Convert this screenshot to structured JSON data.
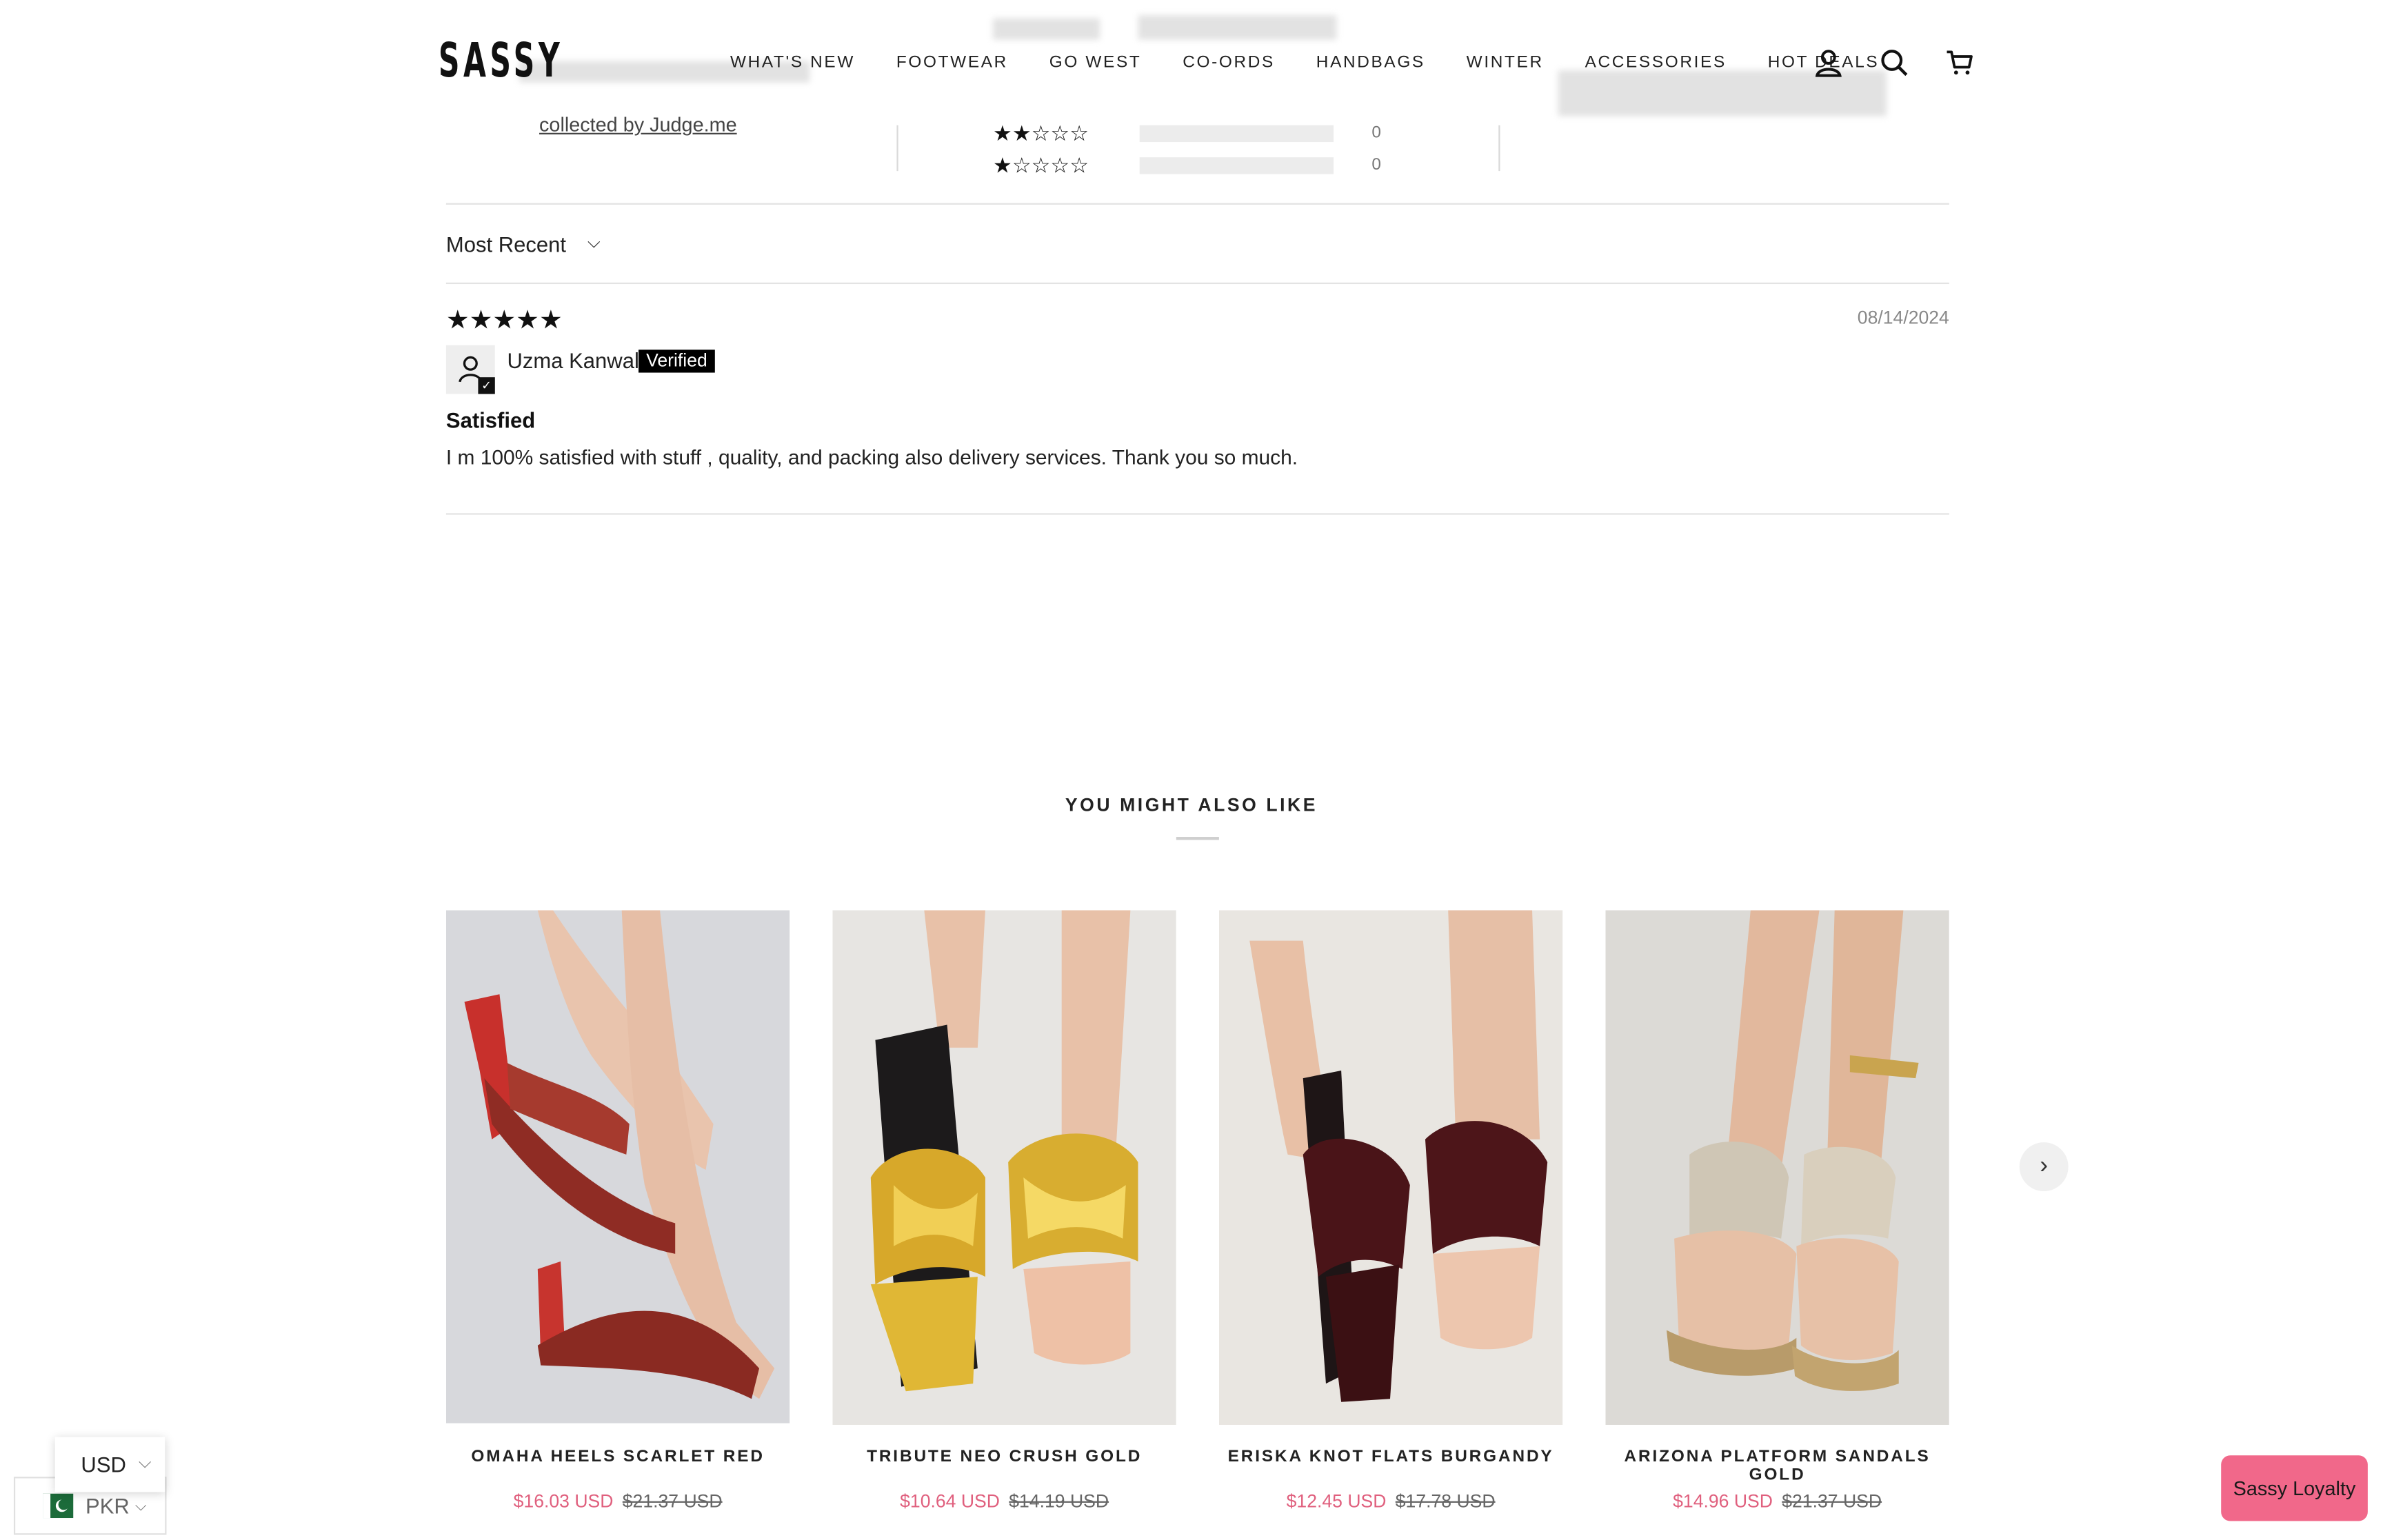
{
  "header": {
    "logo": "SASSY",
    "nav": [
      "WHAT'S NEW",
      "FOOTWEAR",
      "GO WEST",
      "CO-ORDS",
      "HANDBAGS",
      "WINTER",
      "ACCESSORIES",
      "HOT DEALS"
    ],
    "icons": [
      "account-icon",
      "search-icon",
      "cart-icon"
    ]
  },
  "ratings_summary": {
    "link_text": "collected by Judge.me",
    "rows": [
      {
        "stars": "★★☆☆☆",
        "count": "0"
      },
      {
        "stars": "★☆☆☆☆",
        "count": "0"
      }
    ]
  },
  "sort": {
    "label": "Most Recent"
  },
  "review": {
    "stars": "★★★★★",
    "date": "08/14/2024",
    "reviewer": "Uzma Kanwal",
    "badge": "Verified",
    "title": "Satisfied",
    "body": "I m 100% satisfied with stuff , quality, and packing also delivery services. Thank you so much."
  },
  "recommendations": {
    "title": "YOU MIGHT ALSO LIKE",
    "products": [
      {
        "name": "OMAHA HEELS SCARLET RED",
        "price": "$16.03 USD",
        "compare_price": "$21.37 USD"
      },
      {
        "name": "TRIBUTE NEO CRUSH GOLD",
        "price": "$10.64 USD",
        "compare_price": "$14.19 USD"
      },
      {
        "name": "ERISKA KNOT FLATS BURGANDY",
        "price": "$12.45 USD",
        "compare_price": "$17.78 USD"
      },
      {
        "name": "ARIZONA PLATFORM SANDALS GOLD",
        "price": "$14.96 USD",
        "compare_price": "$21.37 USD"
      }
    ]
  },
  "currency": {
    "selected": "USD",
    "country": "PKR"
  },
  "loyalty": {
    "label": "Sassy Loyalty"
  },
  "colors": {
    "sale": "#e0607e",
    "loyalty_bg": "#f1688a"
  }
}
